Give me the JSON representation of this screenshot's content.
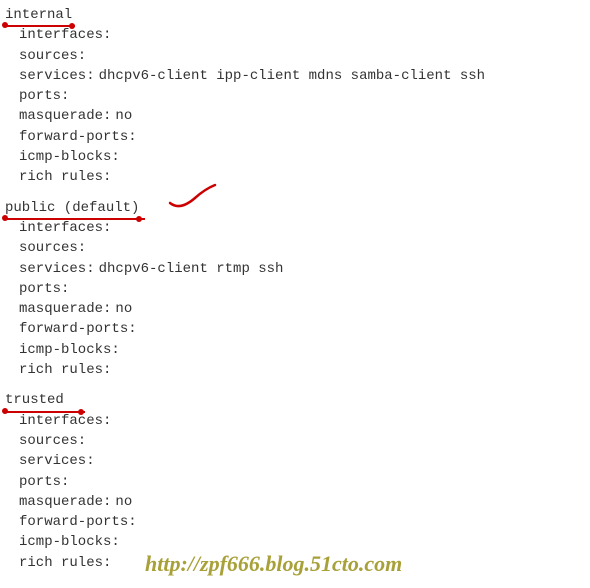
{
  "zones": [
    {
      "name": "internal",
      "underlineWidth": 70,
      "fields": {
        "interfaces": "",
        "sources": "",
        "services": "dhcpv6-client ipp-client mdns samba-client ssh",
        "ports": "",
        "masquerade": "no",
        "forward_ports": "",
        "icmp_blocks": "",
        "rich_rules": ""
      },
      "labels": {
        "interfaces": "interfaces:",
        "sources": "sources:",
        "services": "services:",
        "ports": "ports:",
        "masquerade": "masquerade:",
        "forward_ports": "forward-ports:",
        "icmp_blocks": "icmp-blocks:",
        "rich_rules": "rich rules:"
      }
    },
    {
      "name": "public (default)",
      "underlineWidth": 140,
      "hasCheckmark": true,
      "fields": {
        "interfaces": "",
        "sources": "",
        "services": "dhcpv6-client rtmp ssh",
        "ports": "",
        "masquerade": "no",
        "forward_ports": "",
        "icmp_blocks": "",
        "rich_rules": ""
      },
      "labels": {
        "interfaces": "interfaces:",
        "sources": "sources:",
        "services": "services:",
        "ports": "ports:",
        "masquerade": "masquerade:",
        "forward_ports": "forward-ports:",
        "icmp_blocks": "icmp-blocks:",
        "rich_rules": "rich rules:"
      }
    },
    {
      "name": "trusted",
      "underlineWidth": 62,
      "fields": {
        "interfaces": "",
        "sources": "",
        "services": "",
        "ports": "",
        "masquerade": "no",
        "forward_ports": "",
        "icmp_blocks": "",
        "rich_rules": ""
      },
      "labels": {
        "interfaces": "interfaces:",
        "sources": "sources:",
        "services": "services:",
        "ports": "ports:",
        "masquerade": "masquerade:",
        "forward_ports": "forward-ports:",
        "icmp_blocks": "icmp-blocks:",
        "rich_rules": "rich rules:"
      }
    }
  ],
  "watermark": "http://zpf666.blog.51cto.com"
}
